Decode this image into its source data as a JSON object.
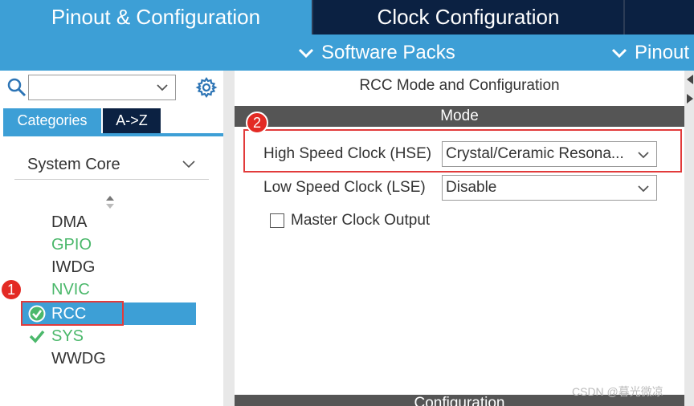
{
  "tabs": {
    "pinout": "Pinout & Configuration",
    "clock": "Clock Configuration"
  },
  "menu": {
    "software_packs": "Software Packs",
    "pinout": "Pinout"
  },
  "left": {
    "search_value": "",
    "category_tabs": {
      "categories": "Categories",
      "az": "A->Z"
    },
    "group": "System Core",
    "items": [
      {
        "label": "DMA",
        "state": "normal"
      },
      {
        "label": "GPIO",
        "state": "configured"
      },
      {
        "label": "IWDG",
        "state": "normal"
      },
      {
        "label": "NVIC",
        "state": "configured"
      },
      {
        "label": "RCC",
        "state": "selected-ok"
      },
      {
        "label": "SYS",
        "state": "ok"
      },
      {
        "label": "WWDG",
        "state": "normal"
      }
    ]
  },
  "right": {
    "title": "RCC Mode and Configuration",
    "mode_header": "Mode",
    "hse_label": "High Speed Clock (HSE)",
    "hse_value": "Crystal/Ceramic Resona...",
    "lse_label": "Low Speed Clock (LSE)",
    "lse_value": "Disable",
    "master_clock_label": "Master Clock Output",
    "master_clock_checked": false,
    "config_header": "Configuration"
  },
  "annotations": {
    "badge1": "1",
    "badge2": "2"
  },
  "watermark": "CSDN @暮光微凉",
  "colors": {
    "primary_blue": "#3d9fd6",
    "dark_navy": "#0b2142",
    "green": "#4bb86b",
    "highlight_red": "#e23b3b"
  }
}
